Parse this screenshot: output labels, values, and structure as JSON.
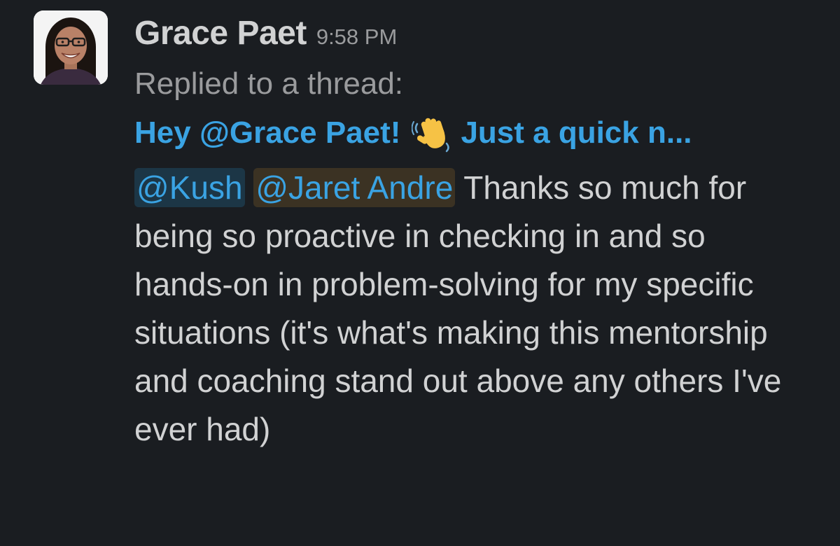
{
  "message": {
    "sender": "Grace Paet",
    "timestamp": "9:58 PM",
    "reply_label": "Replied to a thread:",
    "thread_preview": {
      "before_emoji": "Hey @Grace Paet!",
      "emoji": "waving-hand",
      "after_emoji": "Just a quick n..."
    },
    "mentions": [
      "@Kush",
      "@Jaret Andre"
    ],
    "body_text": "Thanks so much for being so proactive in checking in and so hands-on in problem-solving for my specific situations (it's what's making this mentorship and coaching stand out above any others I've ever had)"
  },
  "colors": {
    "background": "#1a1d21",
    "text": "#d1d2d3",
    "muted": "#9a9b9d",
    "link": "#3aa3e3",
    "mention_bg_kush": "#1c3646",
    "mention_bg_jaret": "#3b3223"
  }
}
